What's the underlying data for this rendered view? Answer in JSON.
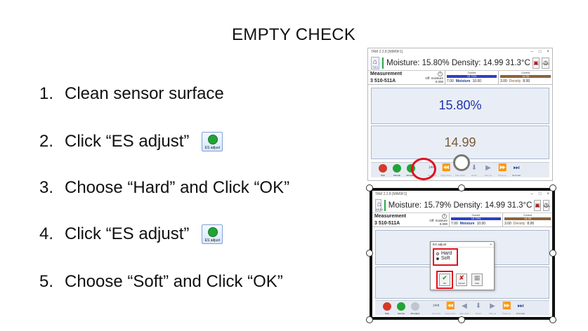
{
  "slide": {
    "title": "EMPTY CHECK"
  },
  "steps": [
    {
      "num": "1.",
      "text": "Clean sensor surface"
    },
    {
      "num": "2.",
      "text": "Click “ES adjust”",
      "badge": "ES adjust"
    },
    {
      "num": "3.",
      "text": "Choose “Hard” and Click “OK”"
    },
    {
      "num": "4.",
      "text": "Click “ES adjust”",
      "badge": "ES adjust"
    },
    {
      "num": "5.",
      "text": "Choose “Soft” and Click “OK”"
    }
  ],
  "window_top": {
    "title": "TAM 2.2.8 [MIM9F1]",
    "controls": {
      "minimize": "–",
      "maximize": "□",
      "close": "×"
    },
    "home_version": "7.0.1",
    "headline": "Moisture: 15.80% Density: 14.99    31.3°C",
    "help": "Help",
    "history": "History",
    "measurement_label": "Measurement",
    "product": "3 510-511A",
    "offset_label": "Off. moisture",
    "offset_value": "0.000",
    "current_label": "Current",
    "moisture_bar": "15.79%",
    "density_bar": "14.99",
    "moisture_min": "7.00",
    "moisture_text": "Moisture",
    "moisture_max": "10.00",
    "density_min": "3.00",
    "density_text": "Density",
    "density_max": "8.00",
    "big_moisture": "15.80%",
    "big_density": "14.99",
    "toolbar": [
      "Stop",
      "Sample",
      "ES adjust",
      "Goto first",
      "Page down",
      "Step down",
      "Reset",
      "Step up",
      "Page up",
      "Goto last"
    ]
  },
  "window_bottom": {
    "title": "TAM 2.2.8 [MIM9F1]",
    "home_version": "4.0.0.1",
    "headline": "Moisture: 15.79% Density: 14.99    31.3°C",
    "measurement_label": "Measurement",
    "product": "3 510-511A",
    "offset_label": "Off. moisture",
    "offset_value": "0.000",
    "current_label": "Current",
    "moisture_bar": "15.79%",
    "density_bar": "14.99",
    "moisture_min": "7.00",
    "moisture_text": "Moisture",
    "moisture_max": "10.00",
    "density_min": "3.00",
    "density_text": "Density",
    "density_max": "8.00",
    "dialog": {
      "title": "ES adjust",
      "options": [
        "Hard",
        "Soft"
      ],
      "selected": "Soft",
      "ok": "OK",
      "cancel": "Cancel",
      "calc": "Calc"
    },
    "toolbar": [
      "Stop",
      "Sample",
      "ES adjust",
      "Goto first",
      "Page down",
      "Step down",
      "Reset",
      "Step up",
      "Page up",
      "Goto last"
    ]
  },
  "colors": {
    "highlight": "#e0101f",
    "moisture": "#2233aa",
    "density": "#7a5a3a",
    "panel": "#e9eef6"
  }
}
